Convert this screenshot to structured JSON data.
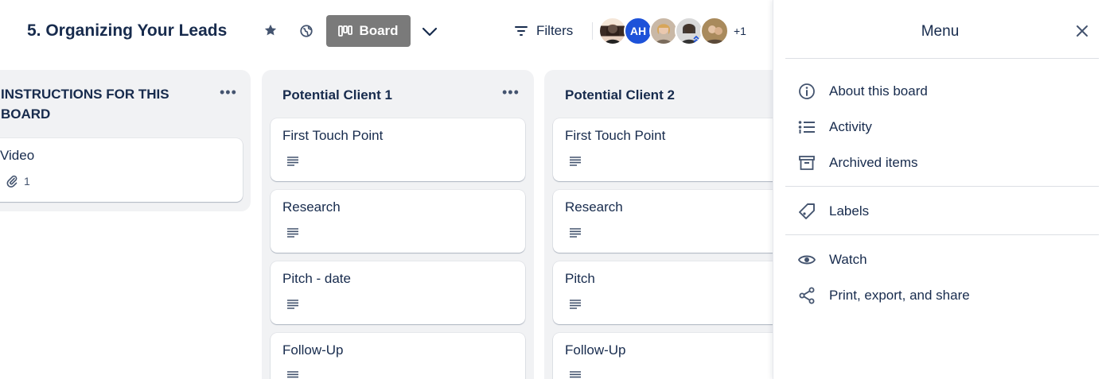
{
  "board": {
    "title": "5. Organizing Your Leads",
    "view_label": "Board",
    "filters_label": "Filters",
    "avatar_initials": "AH",
    "more_members": "+1"
  },
  "lists": [
    {
      "title_line1": "INSTRUCTIONS FOR THIS",
      "title_line2": "BOARD",
      "cards": [
        {
          "title": "Video",
          "attachments": "1"
        }
      ]
    },
    {
      "title": "Potential Client 1",
      "cards": [
        {
          "title": "First Touch Point"
        },
        {
          "title": "Research"
        },
        {
          "title": "Pitch - date"
        },
        {
          "title": "Follow-Up"
        }
      ]
    },
    {
      "title": "Potential Client 2",
      "cards": [
        {
          "title": "First Touch Point"
        },
        {
          "title": "Research"
        },
        {
          "title": "Pitch"
        },
        {
          "title": "Follow-Up"
        }
      ]
    }
  ],
  "menu": {
    "title": "Menu",
    "items": [
      {
        "label": "About this board",
        "icon": "info-icon"
      },
      {
        "label": "Activity",
        "icon": "activity-list-icon"
      },
      {
        "label": "Archived items",
        "icon": "archive-icon"
      },
      {
        "label": "Labels",
        "icon": "label-tag-icon"
      },
      {
        "label": "Watch",
        "icon": "eye-icon"
      },
      {
        "label": "Print, export, and share",
        "icon": "share-icon"
      }
    ]
  },
  "colors": {
    "board_button_bg": "#7a7a7a",
    "list_bg": "#f1f2f4",
    "text": "#172b4d",
    "avatar_ah": "#1d52d9"
  }
}
